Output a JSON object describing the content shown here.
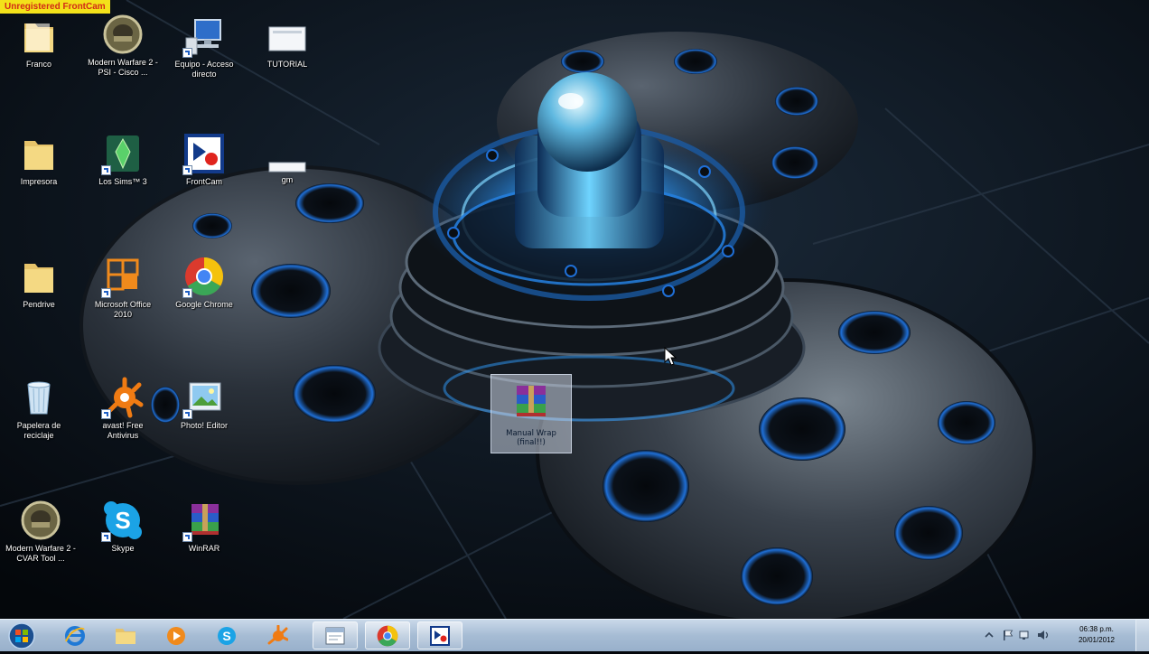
{
  "watermark": "Unregistered FrontCam",
  "desktop_icons": [
    {
      "id": "franco",
      "label": "Franco",
      "icon": "folder-icon"
    },
    {
      "id": "modern-warfare-psi",
      "label": "Modern Warfare 2 - PSI - Cisco ...",
      "icon": "game-soldier-icon"
    },
    {
      "id": "equipo",
      "label": "Equipo - Acceso directo",
      "icon": "computer-icon"
    },
    {
      "id": "tutorial",
      "label": "TUTORIAL",
      "icon": "document-thumbnail-icon"
    },
    {
      "id": "impresora",
      "label": "Impresora",
      "icon": "folder-icon"
    },
    {
      "id": "los-sims",
      "label": "Los Sims™ 3",
      "icon": "sims-icon"
    },
    {
      "id": "frontcam",
      "label": "FrontCam",
      "icon": "frontcam-icon"
    },
    {
      "id": "gm",
      "label": "gm",
      "icon": "document-thumbnail-icon"
    },
    {
      "id": "pendrive",
      "label": "Pendrive",
      "icon": "folder-icon"
    },
    {
      "id": "office",
      "label": "Microsoft Office 2010",
      "icon": "office-icon"
    },
    {
      "id": "chrome",
      "label": "Google Chrome",
      "icon": "chrome-icon"
    },
    {
      "id": "papelera",
      "label": "Papelera de reciclaje",
      "icon": "recycle-bin-icon"
    },
    {
      "id": "avast",
      "label": "avast! Free Antivirus",
      "icon": "avast-icon"
    },
    {
      "id": "photo-editor",
      "label": "Photo! Editor",
      "icon": "photo-editor-icon"
    },
    {
      "id": "modern-warfare-cvar",
      "label": "Modern Warfare 2 - CVAR Tool ...",
      "icon": "game-soldier-icon"
    },
    {
      "id": "skype",
      "label": "Skype",
      "icon": "skype-icon"
    },
    {
      "id": "winrar",
      "label": "WinRAR",
      "icon": "winrar-icon"
    }
  ],
  "selected_file": {
    "label": "Manual Wrap (final!!)",
    "icon": "winrar-archive-icon"
  },
  "taskbar": {
    "start": "start-orb-icon",
    "pinned": [
      {
        "id": "ie",
        "icon": "internet-explorer-icon",
        "open": false
      },
      {
        "id": "explorer",
        "icon": "folder-icon",
        "open": false
      },
      {
        "id": "media-player",
        "icon": "media-player-icon",
        "open": false
      },
      {
        "id": "skype",
        "icon": "skype-icon",
        "open": false
      },
      {
        "id": "avast",
        "icon": "avast-icon",
        "open": false
      },
      {
        "id": "window",
        "icon": "window-icon",
        "open": true
      },
      {
        "id": "chrome",
        "icon": "chrome-icon",
        "open": true
      },
      {
        "id": "frontcam",
        "icon": "frontcam-icon",
        "open": true
      }
    ],
    "clock_time": "06:38 p.m.",
    "clock_date": "20/01/2012"
  },
  "colors": {
    "watermark_bg": "#f3e11a",
    "watermark_text": "#d22a16",
    "glow_blue": "#2f9dff",
    "taskbar": "#a6bcd4"
  }
}
